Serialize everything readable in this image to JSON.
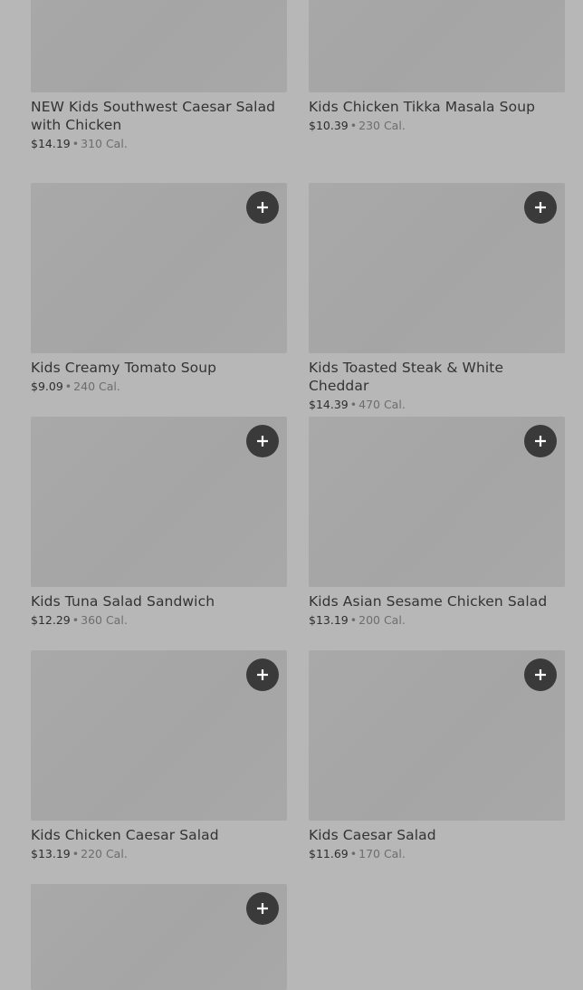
{
  "menu": {
    "items": [
      {
        "name": "NEW Kids Southwest Caesar Salad with Chicken",
        "price": "$14.19",
        "separator": "•",
        "calories": "310 Cal.",
        "add_icon": "plus-icon"
      },
      {
        "name": "Kids Chicken Tikka Masala Soup",
        "price": "$10.39",
        "separator": "•",
        "calories": "230 Cal.",
        "add_icon": "plus-icon"
      },
      {
        "name": "Kids Creamy Tomato Soup",
        "price": "$9.09",
        "separator": "•",
        "calories": "240 Cal.",
        "add_icon": "plus-icon"
      },
      {
        "name": "Kids Toasted Steak & White Cheddar",
        "price": "$14.39",
        "separator": "•",
        "calories": "470 Cal.",
        "add_icon": "plus-icon"
      },
      {
        "name": "Kids Tuna Salad Sandwich",
        "price": "$12.29",
        "separator": "•",
        "calories": "360 Cal.",
        "add_icon": "plus-icon"
      },
      {
        "name": "Kids Asian Sesame Chicken Salad",
        "price": "$13.19",
        "separator": "•",
        "calories": "200 Cal.",
        "add_icon": "plus-icon"
      },
      {
        "name": "Kids Chicken Caesar Salad",
        "price": "$13.19",
        "separator": "•",
        "calories": "220 Cal.",
        "add_icon": "plus-icon"
      },
      {
        "name": "Kids Caesar Salad",
        "price": "$11.69",
        "separator": "•",
        "calories": "170 Cal.",
        "add_icon": "plus-icon"
      },
      {
        "name": "",
        "price": "",
        "separator": "",
        "calories": "",
        "add_icon": "plus-icon"
      }
    ]
  },
  "colors": {
    "background": "#b7b7b7",
    "thumbnail": "#a7a7a7",
    "add_button": "#3a3a3a",
    "title_text": "#333333",
    "muted_text": "#6d6d6d"
  }
}
